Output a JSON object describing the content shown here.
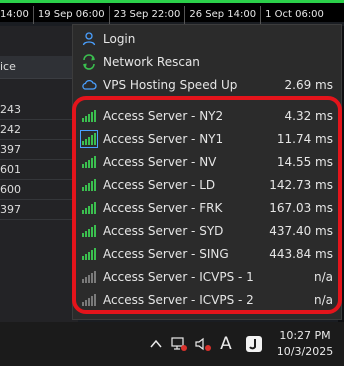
{
  "background": {
    "timeline": [
      "14:00",
      "19 Sep 06:00",
      "23 Sep 22:00",
      "26 Sep 14:00",
      "1 Oct 06:00"
    ],
    "table_header": "ice",
    "table_values": [
      "243",
      "242",
      "397",
      "601",
      "600",
      "397"
    ]
  },
  "menu": {
    "login": {
      "label": "Login",
      "icon": "user-icon"
    },
    "network_rescan": {
      "label": "Network Rescan",
      "icon": "refresh-icon"
    },
    "vps_speed": {
      "label": "VPS Hosting Speed Up",
      "value": "2.69 ms",
      "icon": "cloud-icon"
    },
    "servers": [
      {
        "label": "Access Server - NY2",
        "value": "4.32 ms",
        "status": "green"
      },
      {
        "label": "Access Server - NY1",
        "value": "11.74 ms",
        "status": "green"
      },
      {
        "label": "Access Server - NV",
        "value": "14.55 ms",
        "status": "green"
      },
      {
        "label": "Access Server - LD",
        "value": "142.73 ms",
        "status": "green"
      },
      {
        "label": "Access Server - FRK",
        "value": "167.03 ms",
        "status": "green"
      },
      {
        "label": "Access Server - SYD",
        "value": "437.40 ms",
        "status": "green"
      },
      {
        "label": "Access Server - SING",
        "value": "443.84 ms",
        "status": "green"
      },
      {
        "label": "Access Server - ICVPS - 1",
        "value": "n/a",
        "status": "gray"
      },
      {
        "label": "Access Server - ICVPS - 2",
        "value": "n/a",
        "status": "gray"
      }
    ]
  },
  "taskbar": {
    "time": "10:27 PM",
    "date": "10/3/2025",
    "ime_label": "A"
  },
  "colors": {
    "accent_green": "#3bbf4f",
    "highlight_red": "#e4141b",
    "menu_bg": "#2b2b2b"
  }
}
